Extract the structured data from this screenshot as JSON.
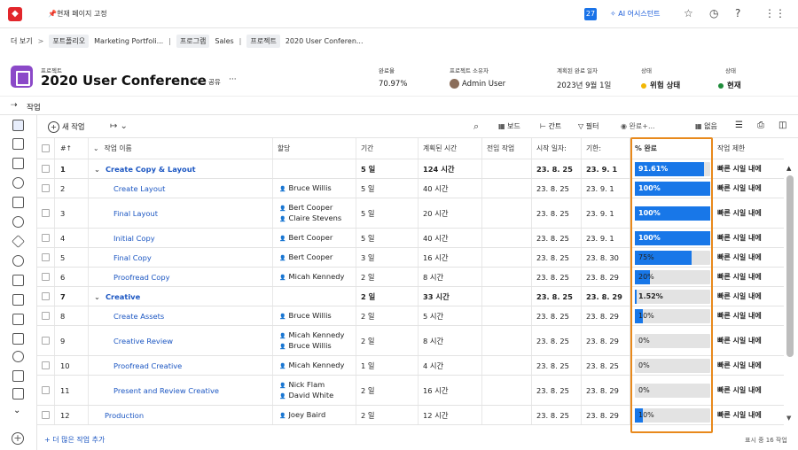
{
  "topbar": {
    "pin_label": "현재 페이지 고정",
    "notification_count": "27",
    "ai_label": "AI 어시스턴트"
  },
  "breadcrumb": {
    "more": "더 보기",
    "sep": ">",
    "portfolio_chip": "포트폴리오",
    "portfolio": "Marketing Portfoli...",
    "program_chip": "프로그램",
    "program": "Sales",
    "project_chip": "프로젝트",
    "project": "2020 User Conferen..."
  },
  "project": {
    "type_label": "프로젝트",
    "title": "2020 User Conference",
    "share": "공유",
    "more": "···"
  },
  "stats": [
    {
      "label": "완료율",
      "value": "70.97%"
    },
    {
      "label": "프로젝트 소유자",
      "value": "Admin User"
    },
    {
      "label": "계획된 완료 일자",
      "value": "2023년 9월 1일"
    },
    {
      "label": "상태",
      "value": "위험 상태",
      "dot_color": "#f2b705"
    },
    {
      "label": "상태",
      "value": "현재",
      "dot_color": "#1e8c3a"
    }
  ],
  "tasks_tab": "작업",
  "toolbar": {
    "new_task": "새 작업",
    "board": "보드",
    "gantt": "간트",
    "filter": "필터",
    "completion": "완료+...",
    "none": "없음"
  },
  "columns": [
    "#",
    "작업 이름",
    "할당",
    "기간",
    "계획된 시간",
    "전임 작업",
    "시작 일자:",
    "기한:",
    "% 완료",
    "작업 제한"
  ],
  "rows": [
    {
      "num": "1",
      "name": "Create Copy & Layout",
      "assign": [],
      "dur": "5 일",
      "hours": "124 시간",
      "start": "23. 8. 25",
      "due": "23. 9. 1",
      "pct": 91.61,
      "pct_label": "91.61%",
      "constraint": "빠른 시일 내에",
      "bold": true,
      "collapse": true,
      "indent": 0
    },
    {
      "num": "2",
      "name": "Create Layout",
      "assign": [
        "Bruce Willis"
      ],
      "dur": "5 일",
      "hours": "40 시간",
      "start": "23. 8. 25",
      "due": "23. 9. 1",
      "pct": 100,
      "pct_label": "100%",
      "constraint": "빠른 시일 내에",
      "bold": false,
      "indent": 1
    },
    {
      "num": "3",
      "name": "Final Layout",
      "assign": [
        "Bert Cooper",
        "Claire Stevens"
      ],
      "dur": "5 일",
      "hours": "20 시간",
      "start": "23. 8. 25",
      "due": "23. 9. 1",
      "pct": 100,
      "pct_label": "100%",
      "constraint": "빠른 시일 내에",
      "bold": false,
      "indent": 1
    },
    {
      "num": "4",
      "name": "Initial Copy",
      "assign": [
        "Bert Cooper"
      ],
      "dur": "5 일",
      "hours": "40 시간",
      "start": "23. 8. 25",
      "due": "23. 9. 1",
      "pct": 100,
      "pct_label": "100%",
      "constraint": "빠른 시일 내에",
      "bold": false,
      "indent": 1
    },
    {
      "num": "5",
      "name": "Final Copy",
      "assign": [
        "Bert Cooper"
      ],
      "dur": "3 일",
      "hours": "16 시간",
      "start": "23. 8. 25",
      "due": "23. 8. 30",
      "pct": 75,
      "pct_label": "75%",
      "constraint": "빠른 시일 내에",
      "bold": false,
      "indent": 1
    },
    {
      "num": "6",
      "name": "Proofread Copy",
      "assign": [
        "Micah Kennedy"
      ],
      "dur": "2 일",
      "hours": "8 시간",
      "start": "23. 8. 25",
      "due": "23. 8. 29",
      "pct": 20,
      "pct_label": "20%",
      "constraint": "빠른 시일 내에",
      "bold": false,
      "indent": 1
    },
    {
      "num": "7",
      "name": "Creative",
      "assign": [],
      "dur": "2 일",
      "hours": "33 시간",
      "start": "23. 8. 25",
      "due": "23. 8. 29",
      "pct": 1.52,
      "pct_label": "1.52%",
      "constraint": "빠른 시일 내에",
      "bold": true,
      "collapse": true,
      "indent": 0
    },
    {
      "num": "8",
      "name": "Create Assets",
      "assign": [
        "Bruce Willis"
      ],
      "dur": "2 일",
      "hours": "5 시간",
      "start": "23. 8. 25",
      "due": "23. 8. 29",
      "pct": 10,
      "pct_label": "10%",
      "constraint": "빠른 시일 내에",
      "bold": false,
      "indent": 1
    },
    {
      "num": "9",
      "name": "Creative Review",
      "assign": [
        "Micah Kennedy",
        "Bruce Willis"
      ],
      "dur": "2 일",
      "hours": "8 시간",
      "start": "23. 8. 25",
      "due": "23. 8. 29",
      "pct": 0,
      "pct_label": "0%",
      "constraint": "빠른 시일 내에",
      "bold": false,
      "indent": 1
    },
    {
      "num": "10",
      "name": "Proofread Creative",
      "assign": [
        "Micah Kennedy"
      ],
      "dur": "1 일",
      "hours": "4 시간",
      "start": "23. 8. 25",
      "due": "23. 8. 25",
      "pct": 0,
      "pct_label": "0%",
      "constraint": "빠른 시일 내에",
      "bold": false,
      "indent": 1
    },
    {
      "num": "11",
      "name": "Present and Review Creative",
      "assign": [
        "Nick Flam",
        "David White"
      ],
      "dur": "2 일",
      "hours": "16 시간",
      "start": "23. 8. 25",
      "due": "23. 8. 29",
      "pct": 0,
      "pct_label": "0%",
      "constraint": "빠른 시일 내에",
      "bold": false,
      "indent": 1
    },
    {
      "num": "12",
      "name": "Production",
      "assign": [
        "Joey Baird"
      ],
      "dur": "2 일",
      "hours": "12 시간",
      "start": "23. 8. 25",
      "due": "23. 8. 29",
      "pct": 10,
      "pct_label": "10%",
      "constraint": "빠른 시일 내에",
      "bold": false,
      "indent": 0
    }
  ],
  "footer": {
    "add_more": "+ 더 많은 작업 추가",
    "count": "표시 중 16 작업"
  }
}
